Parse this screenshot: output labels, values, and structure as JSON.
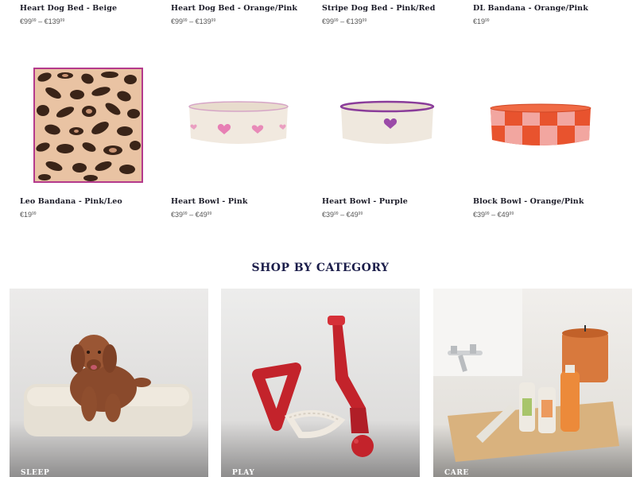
{
  "products_row1": [
    {
      "name": "Heart Dog Bed - Beige",
      "price_from": "€99",
      "price_from_cents": "99",
      "sep": "–",
      "price_to": "€139",
      "price_to_cents": "99"
    },
    {
      "name": "Heart Dog Bed - Orange/Pink",
      "price_from": "€99",
      "price_from_cents": "99",
      "sep": "–",
      "price_to": "€139",
      "price_to_cents": "99"
    },
    {
      "name": "Stripe Dog Bed - Pink/Red",
      "price_from": "€99",
      "price_from_cents": "99",
      "sep": "–",
      "price_to": "€139",
      "price_to_cents": "99"
    },
    {
      "name": "DL Bandana - Orange/Pink",
      "price_from": "€19",
      "price_from_cents": "99"
    }
  ],
  "products_row2": [
    {
      "name": "Leo Bandana - Pink/Leo",
      "price_from": "€19",
      "price_from_cents": "99"
    },
    {
      "name": "Heart Bowl - Pink",
      "price_from": "€39",
      "price_from_cents": "99",
      "sep": "–",
      "price_to": "€49",
      "price_to_cents": "99"
    },
    {
      "name": "Heart Bowl - Purple",
      "price_from": "€39",
      "price_from_cents": "99",
      "sep": "–",
      "price_to": "€49",
      "price_to_cents": "99"
    },
    {
      "name": "Block Bowl - Orange/Pink",
      "price_from": "€39",
      "price_from_cents": "99",
      "sep": "–",
      "price_to": "€49",
      "price_to_cents": "99"
    }
  ],
  "section_title": "SHOP BY CATEGORY",
  "categories": [
    {
      "label": "SLEEP"
    },
    {
      "label": "PLAY"
    },
    {
      "label": "CARE"
    }
  ],
  "colors": {
    "heading": "#1b1d4a",
    "pink_accent": "#c65a9a",
    "purple_accent": "#8a3c9a",
    "orange_block": "#e8532e",
    "pink_block": "#f2a6a0"
  }
}
